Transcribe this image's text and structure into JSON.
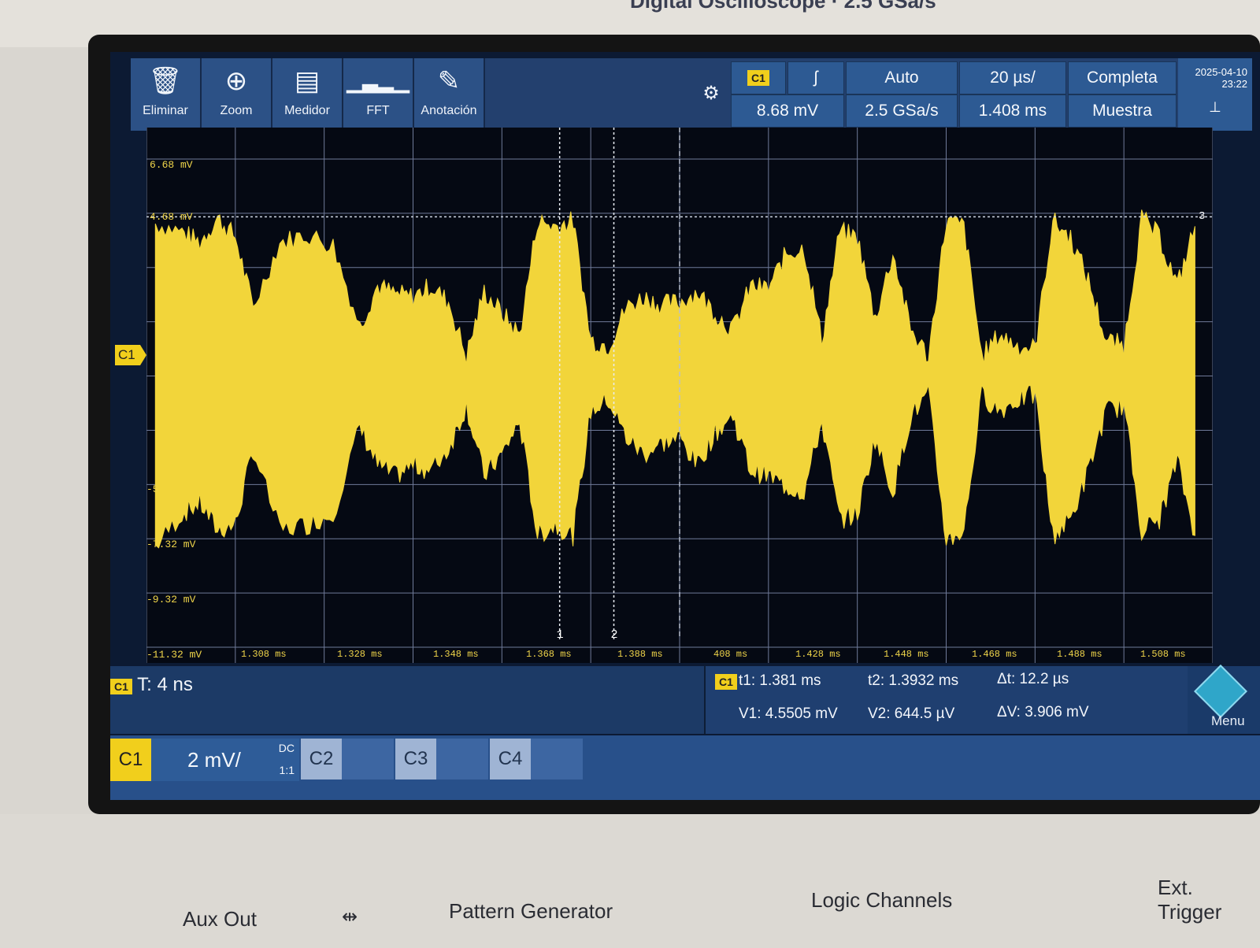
{
  "header": {
    "brand": "Digital Oscilloscope · 2.5 GSa/s"
  },
  "toolbar": {
    "tools": [
      {
        "label": "Eliminar",
        "icon": "trash-icon"
      },
      {
        "label": "Zoom",
        "icon": "zoom-in-icon"
      },
      {
        "label": "Medidor",
        "icon": "meter-icon"
      },
      {
        "label": "FFT",
        "icon": "fft-icon"
      },
      {
        "label": "Anotación",
        "icon": "pencil-icon"
      }
    ],
    "trigger_channel": "C1",
    "trigger_slope": "ʃ",
    "trigger_level": "8.68 mV",
    "trigger_mode": "Auto",
    "sample_rate": "2.5 GSa/s",
    "time_div": "20 µs/",
    "time_offset": "1.408 ms",
    "acq_mode": "Completa",
    "acq_type": "Muestra",
    "date": "2025-04-10",
    "time": "23:22"
  },
  "plot": {
    "y_labels": [
      "6.68 mV",
      "4.68 mV",
      "-5",
      "-7.32 mV",
      "-9.32 mV",
      "-11.32 mV"
    ],
    "x_labels": [
      "1.308 ms",
      "1.328 ms",
      "1.348 ms",
      "1.368 ms",
      "1.388 ms",
      "408 ms",
      "1.428 ms",
      "1.448 ms",
      "1.468 ms",
      "1.488 ms",
      "1.508 ms"
    ],
    "channel_marker": "C1",
    "cursor1_label": "1",
    "cursor2_label": "2",
    "level_marker": "3",
    "trace_color": "#f2d53a"
  },
  "info": {
    "channel": "C1",
    "resolution": "T: 4 ns",
    "t1": "t1: 1.381 ms",
    "t2": "t2: 1.3932 ms",
    "dt": "Δt: 12.2 µs",
    "v1": "V1: 4.5505 mV",
    "v2": "V2: 644.5 µV",
    "dv": "ΔV: 3.906 mV"
  },
  "channels": {
    "c1_label": "C1",
    "c1_scale": "2 mV/",
    "c1_coupling": "DC",
    "c1_probe": "1:1",
    "c2_label": "C2",
    "c3_label": "C3",
    "c4_label": "C4",
    "menu_label": "Menu"
  },
  "front_panel": {
    "aux_out": "Aux Out",
    "pattern_generator": "Pattern Generator",
    "logic_channels": "Logic Channels",
    "ext_trigger": "Ext. Trigger"
  },
  "chart_data": {
    "type": "line",
    "title": "",
    "xlabel": "",
    "ylabel": "",
    "x_unit": "ms",
    "y_unit": "mV",
    "xlim": [
      1.288,
      1.528
    ],
    "ylim": [
      -11.32,
      6.68
    ],
    "envelope": {
      "x": [
        1.29,
        1.296,
        1.3,
        1.304,
        1.308,
        1.312,
        1.318,
        1.324,
        1.33,
        1.336,
        1.34,
        1.344,
        1.348,
        1.352,
        1.356,
        1.36,
        1.364,
        1.368,
        1.372,
        1.376,
        1.38,
        1.384,
        1.388,
        1.392,
        1.396,
        1.4,
        1.404,
        1.408,
        1.412,
        1.416,
        1.42,
        1.424,
        1.428,
        1.432,
        1.436,
        1.44,
        1.444,
        1.448,
        1.452,
        1.456,
        1.46,
        1.464,
        1.468,
        1.472,
        1.476,
        1.48,
        1.484,
        1.488,
        1.492,
        1.496,
        1.5,
        1.504,
        1.508,
        1.512,
        1.516,
        1.52,
        1.524
      ],
      "upper": [
        4.3,
        4.0,
        3.6,
        4.5,
        3.8,
        1.2,
        3.6,
        3.9,
        3.5,
        0.5,
        2.0,
        1.7,
        1.6,
        2.0,
        1.4,
        -0.6,
        1.8,
        1.0,
        0.2,
        4.4,
        4.2,
        4.4,
        0.0,
        -0.2,
        1.2,
        1.6,
        1.3,
        1.4,
        1.8,
        1.0,
        0.4,
        2.0,
        1.9,
        3.2,
        3.4,
        0.0,
        4.0,
        3.8,
        0.8,
        3.2,
        0.4,
        -0.6,
        4.4,
        4.2,
        -0.6,
        0.2,
        -0.2,
        -0.3,
        4.4,
        3.8,
        2.2,
        0.0,
        -0.2,
        4.5,
        3.8,
        2.0,
        4.2
      ],
      "lower": [
        -7.6,
        -6.4,
        -6.0,
        -7.0,
        -6.8,
        -4.0,
        -7.0,
        -6.8,
        -6.4,
        -3.2,
        -4.6,
        -5.0,
        -4.6,
        -4.8,
        -4.0,
        -2.4,
        -5.0,
        -4.2,
        -3.0,
        -7.2,
        -6.8,
        -7.2,
        -2.6,
        -2.2,
        -3.6,
        -4.2,
        -3.8,
        -3.6,
        -4.6,
        -3.4,
        -2.8,
        -4.8,
        -5.0,
        -5.4,
        -5.6,
        -3.0,
        -6.6,
        -6.4,
        -3.6,
        -5.6,
        -2.8,
        -2.0,
        -7.4,
        -7.0,
        -2.0,
        -2.6,
        -2.2,
        -2.0,
        -7.2,
        -6.6,
        -4.8,
        -2.6,
        -2.4,
        -7.0,
        -6.6,
        -4.4,
        -7.2
      ]
    },
    "cursors": {
      "t1_ms": 1.381,
      "t2_ms": 1.3932,
      "trigger_ms": 1.408,
      "level_mV": 4.5505
    },
    "grid": true
  }
}
